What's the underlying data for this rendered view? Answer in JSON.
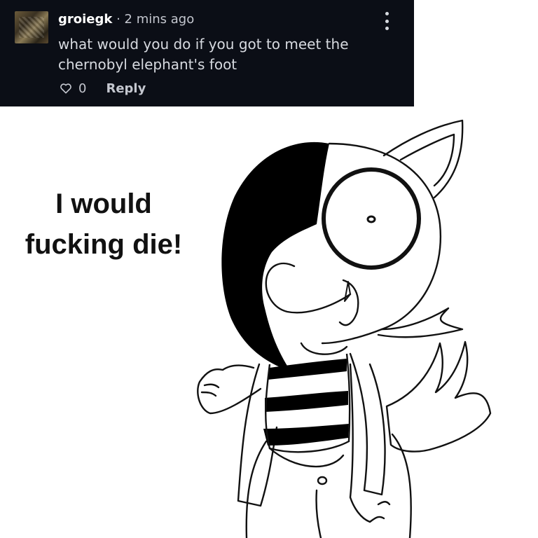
{
  "comment": {
    "username": "groiegk",
    "timestamp": "· 2 mins ago",
    "text": "what would you do if you got to meet the chernobyl elephant's foot",
    "like_count": "0",
    "reply_label": "Reply",
    "icons": {
      "like": "heart-outline-icon",
      "menu": "more-vertical-icon"
    }
  },
  "caption": {
    "line1": "I would",
    "line2": "fucking die!"
  },
  "colors": {
    "card_background": "#0b0e16",
    "page_background": "#ffffff",
    "text_primary": "#ffffff",
    "text_secondary": "#c4c7cf"
  }
}
